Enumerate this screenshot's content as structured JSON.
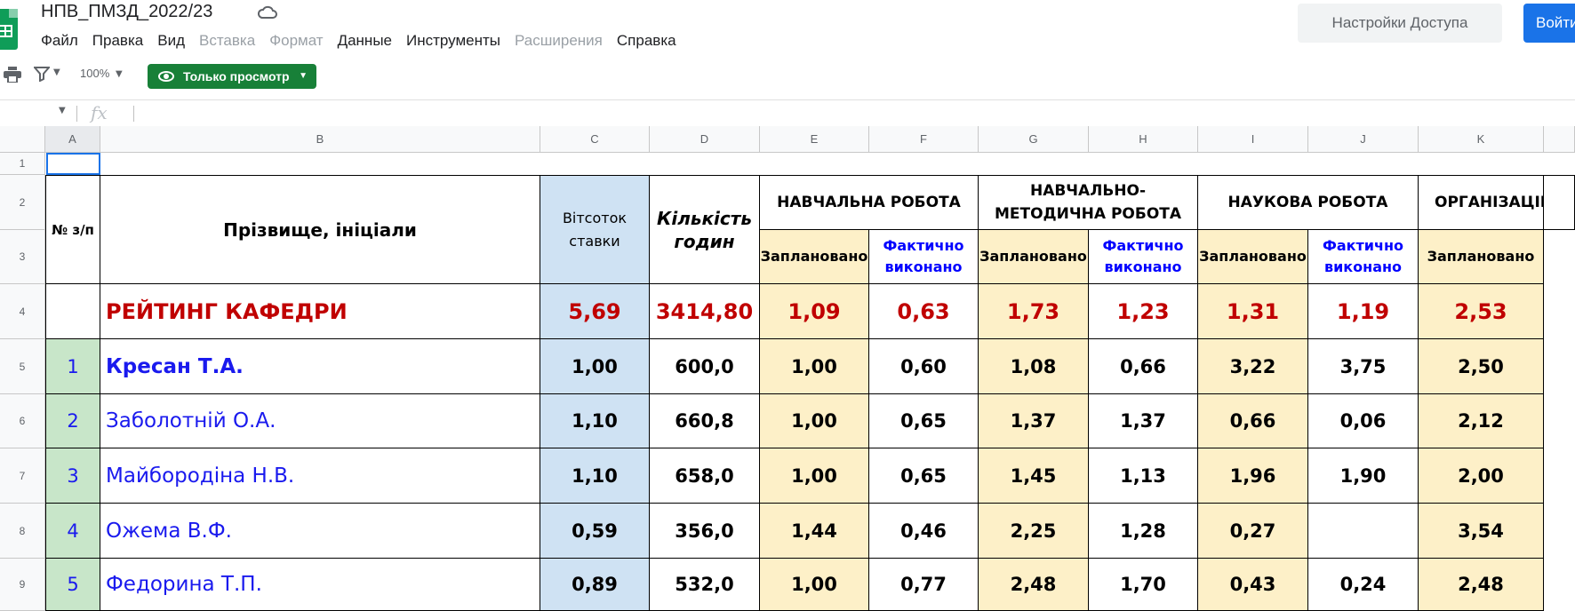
{
  "doc": {
    "title": "НПВ_ПМЗД_2022/23"
  },
  "menu": [
    "Файл",
    "Правка",
    "Вид",
    "Вставка",
    "Формат",
    "Данные",
    "Инструменты",
    "Расширения",
    "Справка"
  ],
  "menu_disabled": [
    false,
    false,
    false,
    true,
    true,
    false,
    false,
    true,
    false
  ],
  "header": {
    "access_label": "Настройки Доступа",
    "signin_label": "Войти"
  },
  "toolbar": {
    "zoom": "100%",
    "view_mode": "Только просмотр"
  },
  "formula_bar": {
    "fx": "fx"
  },
  "columns": [
    "A",
    "B",
    "C",
    "D",
    "E",
    "F",
    "G",
    "H",
    "I",
    "J",
    "K"
  ],
  "rows": [
    "1",
    "2",
    "3",
    "4",
    "5",
    "6",
    "7",
    "8",
    "9"
  ],
  "table": {
    "col_num": "№ з/п",
    "col_name": "Прізвище, ініціали",
    "col_rate": "Вітсоток ставки",
    "col_hours": "Кількість годин",
    "groups": [
      "НАВЧАЛЬНА РОБОТА",
      "НАВЧАЛЬНО-МЕТОДИЧНА РОБОТА",
      "НАУКОВА РОБОТА",
      "ОРГАНІЗАЦІЙНА РОБОТА"
    ],
    "planned": "Заплановано",
    "actual": "Фактично виконано",
    "rating": {
      "label": "РЕЙТИНГ КАФЕДРИ",
      "values": [
        "5,69",
        "3414,80",
        "1,09",
        "0,63",
        "1,73",
        "1,23",
        "1,31",
        "1,19",
        "2,53"
      ]
    },
    "people": [
      {
        "n": "1",
        "name": "Кресан Т.А.",
        "values": [
          "1,00",
          "600,0",
          "1,00",
          "0,60",
          "1,08",
          "0,66",
          "3,22",
          "3,75",
          "2,50"
        ]
      },
      {
        "n": "2",
        "name": "Заболотній О.А.",
        "values": [
          "1,10",
          "660,8",
          "1,00",
          "0,65",
          "1,37",
          "1,37",
          "0,66",
          "0,06",
          "2,12"
        ]
      },
      {
        "n": "3",
        "name": "Майбородіна Н.В.",
        "values": [
          "1,10",
          "658,0",
          "1,00",
          "0,65",
          "1,45",
          "1,13",
          "1,96",
          "1,90",
          "2,00"
        ]
      },
      {
        "n": "4",
        "name": "Ожема В.Ф.",
        "values": [
          "0,59",
          "356,0",
          "1,44",
          "0,46",
          "2,25",
          "1,28",
          "0,27",
          "",
          "3,54"
        ]
      },
      {
        "n": "5",
        "name": "Федорина Т.П.",
        "values": [
          "0,89",
          "532,0",
          "1,00",
          "0,77",
          "2,48",
          "1,70",
          "0,43",
          "0,24",
          "2,48"
        ]
      }
    ]
  },
  "colors": {
    "accent": "#1a73e8",
    "green": "#188038",
    "red": "#c00000",
    "blue_text": "#1a1aee"
  }
}
